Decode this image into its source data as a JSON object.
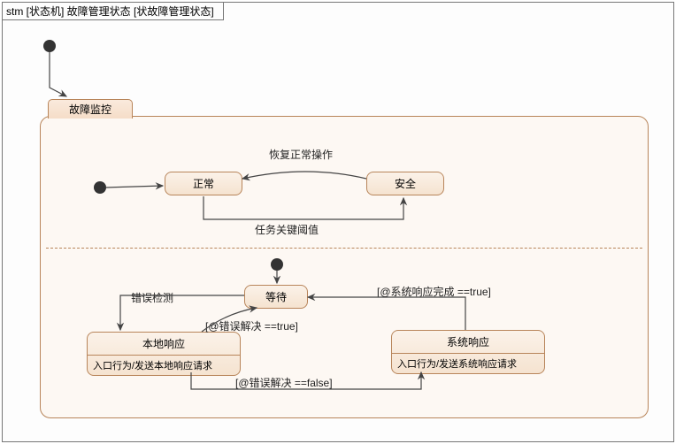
{
  "frame_title": "stm [状态机] 故障管理状态 [状故障管理状态]",
  "composite": {
    "tab": "故障监控"
  },
  "states": {
    "normal": "正常",
    "safe": "安全",
    "wait": "等待",
    "local": {
      "title": "本地响应",
      "entry": "入口行为/发送本地响应请求"
    },
    "system": {
      "title": "系统响应",
      "entry": "入口行为/发送系统响应请求"
    }
  },
  "transitions": {
    "resume": "恢复正常操作",
    "threshold": "任务关键阈值",
    "detect": "错误检测",
    "resolved_true": "[@错误解决 ==true]",
    "resolved_false": "[@错误解决 ==false]",
    "sys_done_true": "[@系统响应完成 ==true]"
  },
  "chart_data": {
    "type": "state_machine",
    "name": "故障管理状态",
    "initial": "故障监控",
    "composite_state": {
      "name": "故障监控",
      "regions": [
        {
          "initial": "正常",
          "states": [
            "正常",
            "安全"
          ],
          "transitions": [
            {
              "from": "安全",
              "to": "正常",
              "trigger": "恢复正常操作"
            },
            {
              "from": "正常",
              "to": "安全",
              "trigger": "任务关键阈值"
            }
          ]
        },
        {
          "initial": "等待",
          "states": [
            {
              "name": "等待"
            },
            {
              "name": "本地响应",
              "entry": "发送本地响应请求"
            },
            {
              "name": "系统响应",
              "entry": "发送系统响应请求"
            }
          ],
          "transitions": [
            {
              "from": "等待",
              "to": "本地响应",
              "trigger": "错误检测"
            },
            {
              "from": "本地响应",
              "to": "等待",
              "guard": "@错误解决 ==true"
            },
            {
              "from": "本地响应",
              "to": "系统响应",
              "guard": "@错误解决 ==false"
            },
            {
              "from": "系统响应",
              "to": "等待",
              "guard": "@系统响应完成 ==true"
            }
          ]
        }
      ]
    }
  }
}
